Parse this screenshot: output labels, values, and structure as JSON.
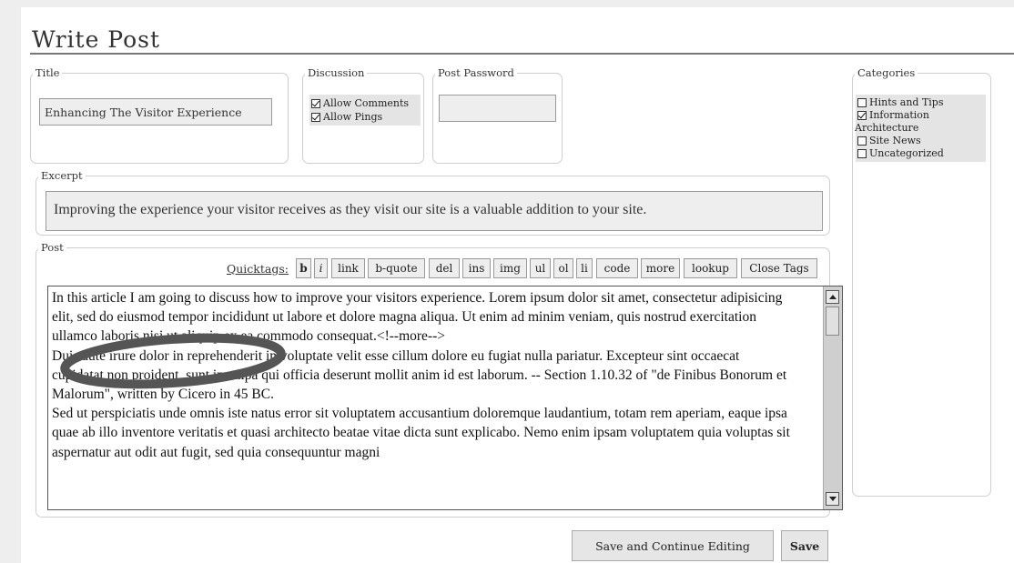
{
  "page_title": "Write Post",
  "title_field": {
    "legend": "Title",
    "value": "Enhancing The Visitor Experience"
  },
  "discussion": {
    "legend": "Discussion",
    "options": [
      {
        "label": "Allow Comments",
        "checked": true
      },
      {
        "label": "Allow Pings",
        "checked": true
      }
    ]
  },
  "post_password": {
    "legend": "Post Password",
    "value": ""
  },
  "excerpt": {
    "legend": "Excerpt",
    "value": "Improving the experience your visitor receives as they visit our site is a valuable addition to your site."
  },
  "post": {
    "legend": "Post",
    "quicktags_label": "Quicktags:",
    "quicktags": [
      "b",
      "i",
      "link",
      "b-quote",
      "del",
      "ins",
      "img",
      "ul",
      "ol",
      "li",
      "code",
      "more",
      "lookup",
      "Close Tags"
    ],
    "content": "In this article I am going to discuss how to improve your visitors experience. Lorem ipsum dolor sit amet, consectetur adipisicing elit, sed do eiusmod tempor incididunt ut labore et dolore magna aliqua. Ut enim ad minim veniam, quis nostrud exercitation ullamco laboris nisi ut aliquip ex ea commodo consequat.<!--more-->\nDuis aute irure dolor in reprehenderit in voluptate velit esse cillum dolore eu fugiat nulla pariatur. Excepteur sint occaecat cupidatat non proident, sunt in culpa qui officia deserunt mollit anim id est laborum. -- Section 1.10.32 of \"de Finibus Bonorum et Malorum\", written by Cicero in 45 BC.\nSed ut perspiciatis unde omnis iste natus error sit voluptatem accusantium doloremque laudantium, totam rem aperiam, eaque ipsa quae ab illo inventore veritatis et quasi architecto beatae vitae dicta sunt explicabo. Nemo enim ipsam voluptatem quia voluptas sit aspernatur aut odit aut fugit, sed quia consequuntur magni"
  },
  "actions": {
    "save_continue_label": "Save and Continue Editing",
    "save_label": "Save"
  },
  "categories": {
    "legend": "Categories",
    "items": [
      {
        "label": "Hints and Tips",
        "checked": false
      },
      {
        "label": "Information Architecture",
        "checked": true
      },
      {
        "label": "Site News",
        "checked": false
      },
      {
        "label": "Uncategorized",
        "checked": false
      }
    ]
  },
  "colors": {
    "page_bg": "#eeeeee",
    "panel_bg": "#ffffff",
    "annotation_circle": "#555555"
  }
}
